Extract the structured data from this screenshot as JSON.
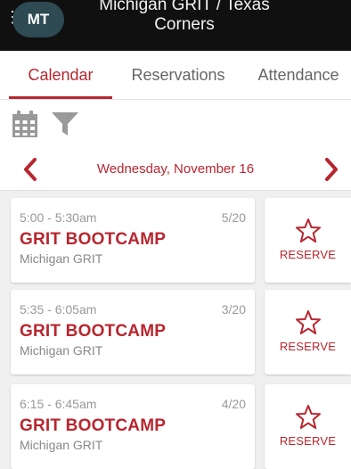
{
  "header": {
    "menu_icon": "vertical-dots-icon",
    "avatar_initials": "MT",
    "title_line1": "Michigan GRIT / Texas",
    "title_line2": "Corners"
  },
  "tabs": [
    {
      "label": "Calendar",
      "active": true
    },
    {
      "label": "Reservations",
      "active": false
    },
    {
      "label": "Attendance",
      "active": false
    }
  ],
  "toolbar": {
    "icons": [
      "calendar-icon",
      "filter-icon"
    ]
  },
  "date_nav": {
    "date": "Wednesday, November 16",
    "prev_icon": "chevron-left-icon",
    "next_icon": "chevron-right-icon"
  },
  "classes": [
    {
      "time": "5:00 - 5:30am",
      "count": "5/20",
      "name": "GRIT BOOTCAMP",
      "location": "Michigan GRIT",
      "action": "RESERVE"
    },
    {
      "time": "5:35 - 6:05am",
      "count": "3/20",
      "name": "GRIT BOOTCAMP",
      "location": "Michigan GRIT",
      "action": "RESERVE"
    },
    {
      "time": "6:15 - 6:45am",
      "count": "4/20",
      "name": "GRIT BOOTCAMP",
      "location": "Michigan GRIT",
      "action": "RESERVE"
    }
  ],
  "colors": {
    "accent": "#b8262f",
    "header_bg": "#101010",
    "avatar_bg": "#2e4a52",
    "page_bg": "#f0f0f0"
  }
}
